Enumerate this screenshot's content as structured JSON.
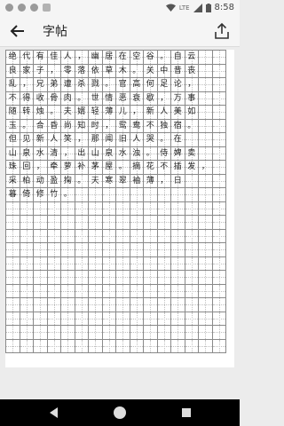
{
  "status": {
    "network": "LTE",
    "time": "8:58"
  },
  "app_bar": {
    "title": "字帖"
  },
  "sheet": {
    "columns": 16,
    "rows": 22,
    "lines": [
      "绝代有佳人，幽居在空谷。自云",
      "良家子，零落依草木。关中昔丧",
      "乱，兄弟遭杀戮。官高何足论，",
      "不得收骨肉。世情恶衰歇，万事",
      "随转烛。夫婿轻薄儿，新人美如",
      "玉。合昏尚知时，鸳鸯不独宿。",
      "但见新人笑，那闻旧人哭。在",
      "山泉水清，出山泉水浊。侍婢卖",
      "珠回，牵萝补茅屋。摘花不插发，",
      "采柏动盈掬。天寒翠袖薄，日",
      "暮倚修竹。"
    ]
  }
}
